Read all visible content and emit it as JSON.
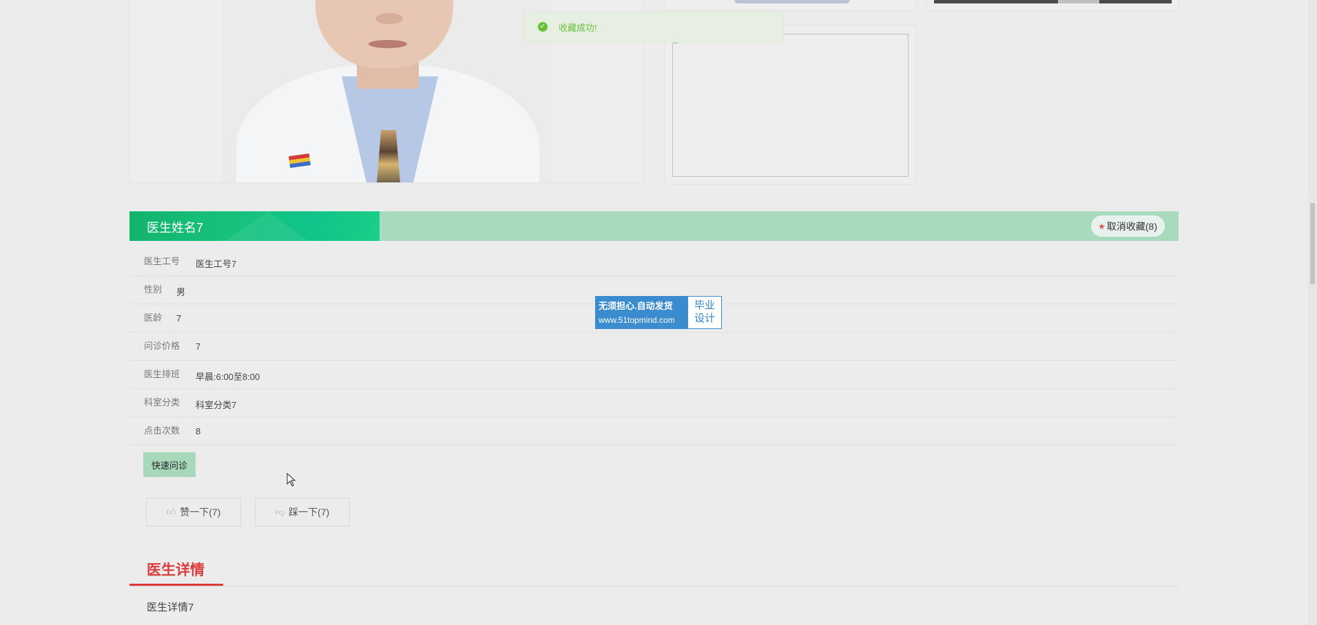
{
  "toast": {
    "message": "收藏成功!"
  },
  "doctor": {
    "name": "医生姓名7",
    "unfavorite_label": "取消收藏(8)"
  },
  "info": [
    {
      "label": "医生工号",
      "value": "医生工号7"
    },
    {
      "label": "性别",
      "value": "男"
    },
    {
      "label": "医龄",
      "value": "7"
    },
    {
      "label": "问诊价格",
      "value": "7"
    },
    {
      "label": "医生排班",
      "value": "早晨:6:00至8:00"
    },
    {
      "label": "科室分类",
      "value": "科室分类7"
    },
    {
      "label": "点击次数",
      "value": "8"
    }
  ],
  "badge": {
    "line1": "无须担心.自动发货",
    "url": "www.51topmind.com",
    "right1": "毕业",
    "right2": "设计"
  },
  "actions": {
    "quick_consult": "快速问诊",
    "like": "赞一下(7)",
    "dislike": "踩一下(7)"
  },
  "details": {
    "title": "医生详情",
    "text": "医生详情7"
  },
  "colors": {
    "banner_green": "#12b36b",
    "details_red": "#dd3b3b",
    "toast_green": "#67c23a"
  }
}
